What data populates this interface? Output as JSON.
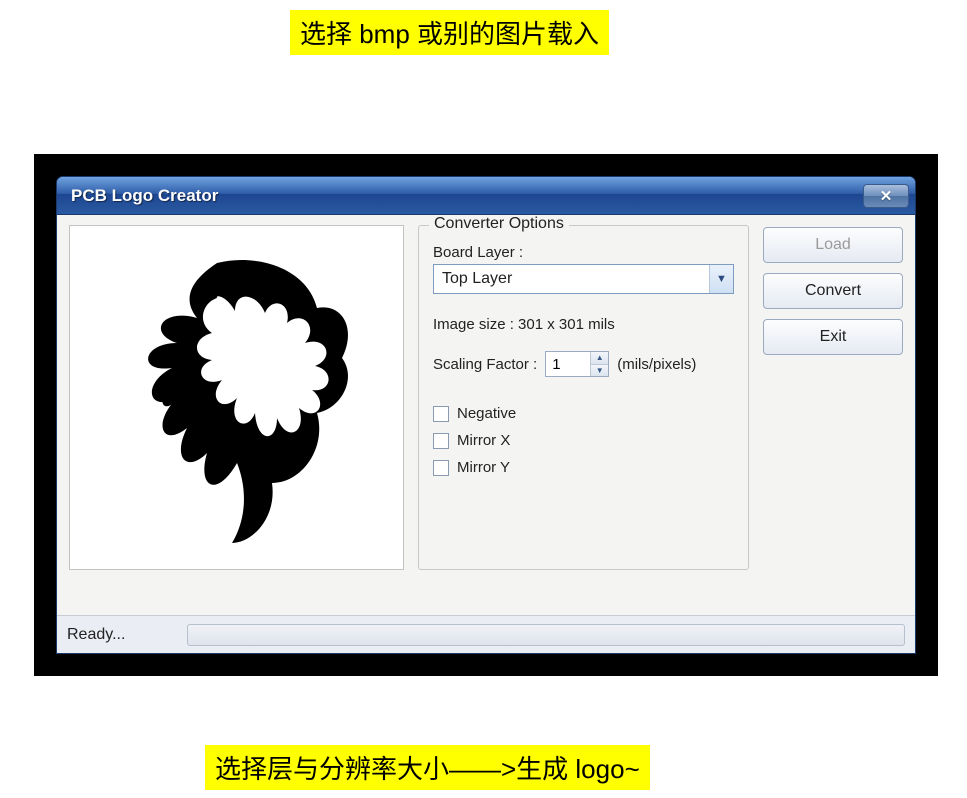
{
  "annotations": {
    "top": "选择 bmp 或别的图片载入",
    "bottom": "选择层与分辨率大小——>生成 logo~"
  },
  "window": {
    "title": "PCB Logo Creator",
    "close_symbol": "✕"
  },
  "options": {
    "group_title": "Converter Options",
    "board_layer_label": "Board Layer :",
    "board_layer_value": "Top Layer",
    "image_size_text": "Image size : 301 x 301 mils",
    "scaling_label": "Scaling Factor :",
    "scaling_value": "1",
    "scaling_unit": "(mils/pixels)",
    "negative_label": "Negative",
    "mirrorx_label": "Mirror X",
    "mirrory_label": "Mirror Y"
  },
  "buttons": {
    "load": "Load",
    "convert": "Convert",
    "exit": "Exit"
  },
  "status": {
    "text": "Ready..."
  }
}
